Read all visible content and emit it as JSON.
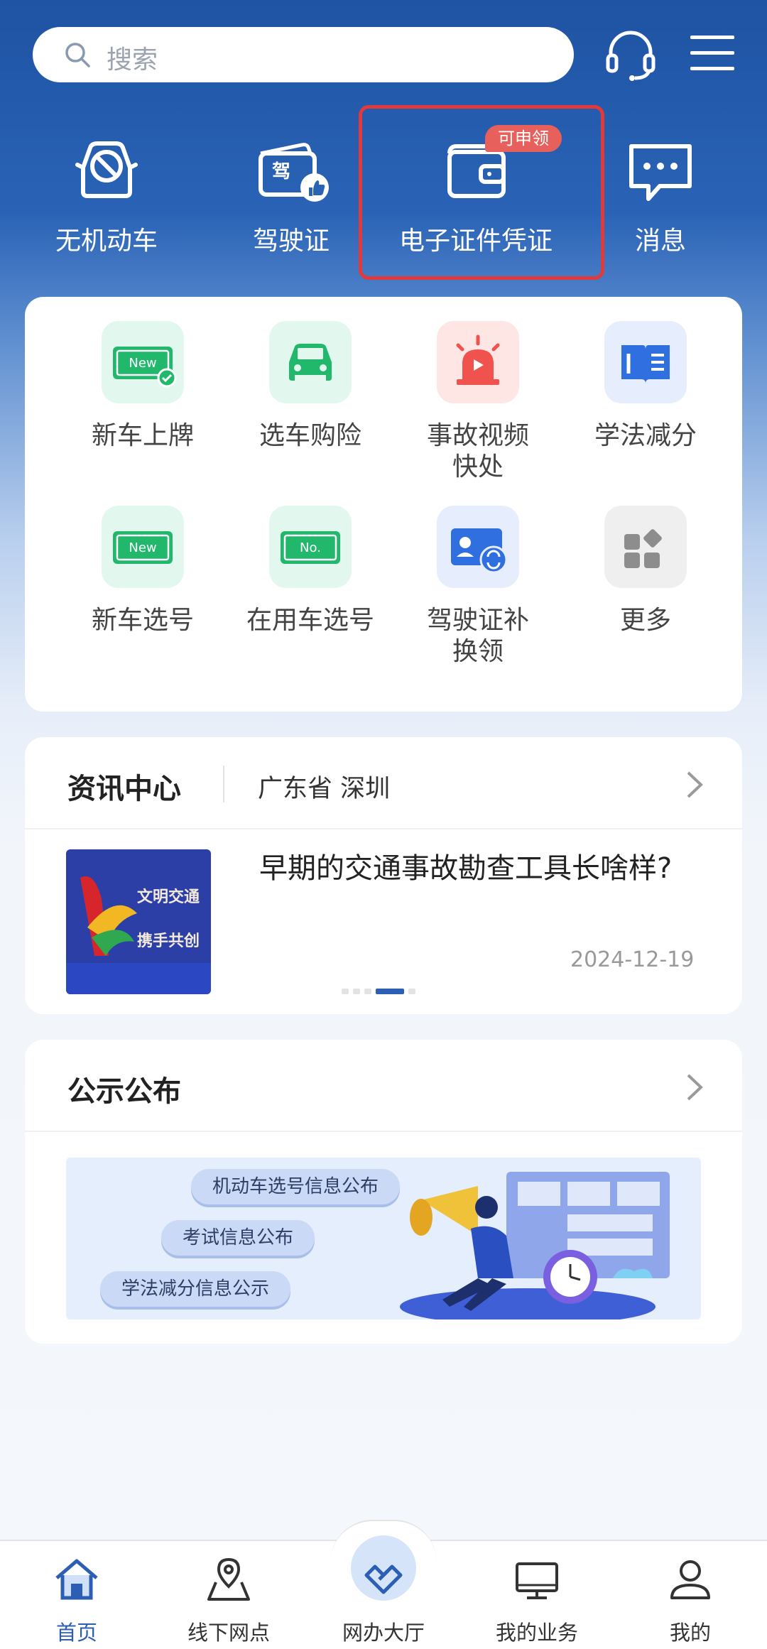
{
  "search": {
    "placeholder": "搜索"
  },
  "header_icons": [
    "customer-service-icon",
    "menu-icon"
  ],
  "top_shortcuts": [
    {
      "label": "无机动车",
      "icon": "no-car-icon"
    },
    {
      "label": "驾驶证",
      "icon": "license-like-icon"
    },
    {
      "label": "电子证件凭证",
      "icon": "wallet-icon",
      "badge": "可申领",
      "highlighted": true
    },
    {
      "label": "消息",
      "icon": "message-icon"
    }
  ],
  "services": [
    {
      "label": "新车上牌",
      "icon": "new-plate-icon"
    },
    {
      "label": "选车购险",
      "icon": "car-insurance-icon"
    },
    {
      "label": "事故视频快处",
      "line1": "事故视频",
      "line2": "快处",
      "icon": "alarm-light-icon"
    },
    {
      "label": "学法减分",
      "icon": "book-icon"
    },
    {
      "label": "新车选号",
      "icon": "new-number-icon"
    },
    {
      "label": "在用车选号",
      "icon": "no-plate-icon"
    },
    {
      "label": "驾驶证补换领",
      "line1": "驾驶证补",
      "line2": "换领",
      "icon": "license-renew-icon"
    },
    {
      "label": "更多",
      "icon": "more-grid-icon"
    }
  ],
  "news": {
    "title": "资讯中心",
    "region": "广东省 深圳",
    "headline": "早期的交通事故勘查工具长啥样?",
    "date": "2024-12-19",
    "thumb_text": "文明交通 携手共创",
    "carousel_active_index": 3,
    "carousel_count": 5
  },
  "notice": {
    "title": "公示公布",
    "pills": [
      "机动车选号信息公布",
      "考试信息公布",
      "学法减分信息公示"
    ]
  },
  "bottom_nav": [
    {
      "label": "首页",
      "icon": "home-icon",
      "active": true
    },
    {
      "label": "线下网点",
      "icon": "map-location-icon"
    },
    {
      "label": "网办大厅",
      "icon": "online-hall-icon"
    },
    {
      "label": "我的业务",
      "icon": "monitor-icon"
    },
    {
      "label": "我的",
      "icon": "user-icon"
    }
  ],
  "colors": {
    "header_blue": "#1f53a3",
    "accent_blue": "#2c5fb3",
    "highlight_red": "#e23a3a",
    "badge_red": "#e8605b",
    "green_icon": "#21b86c"
  }
}
